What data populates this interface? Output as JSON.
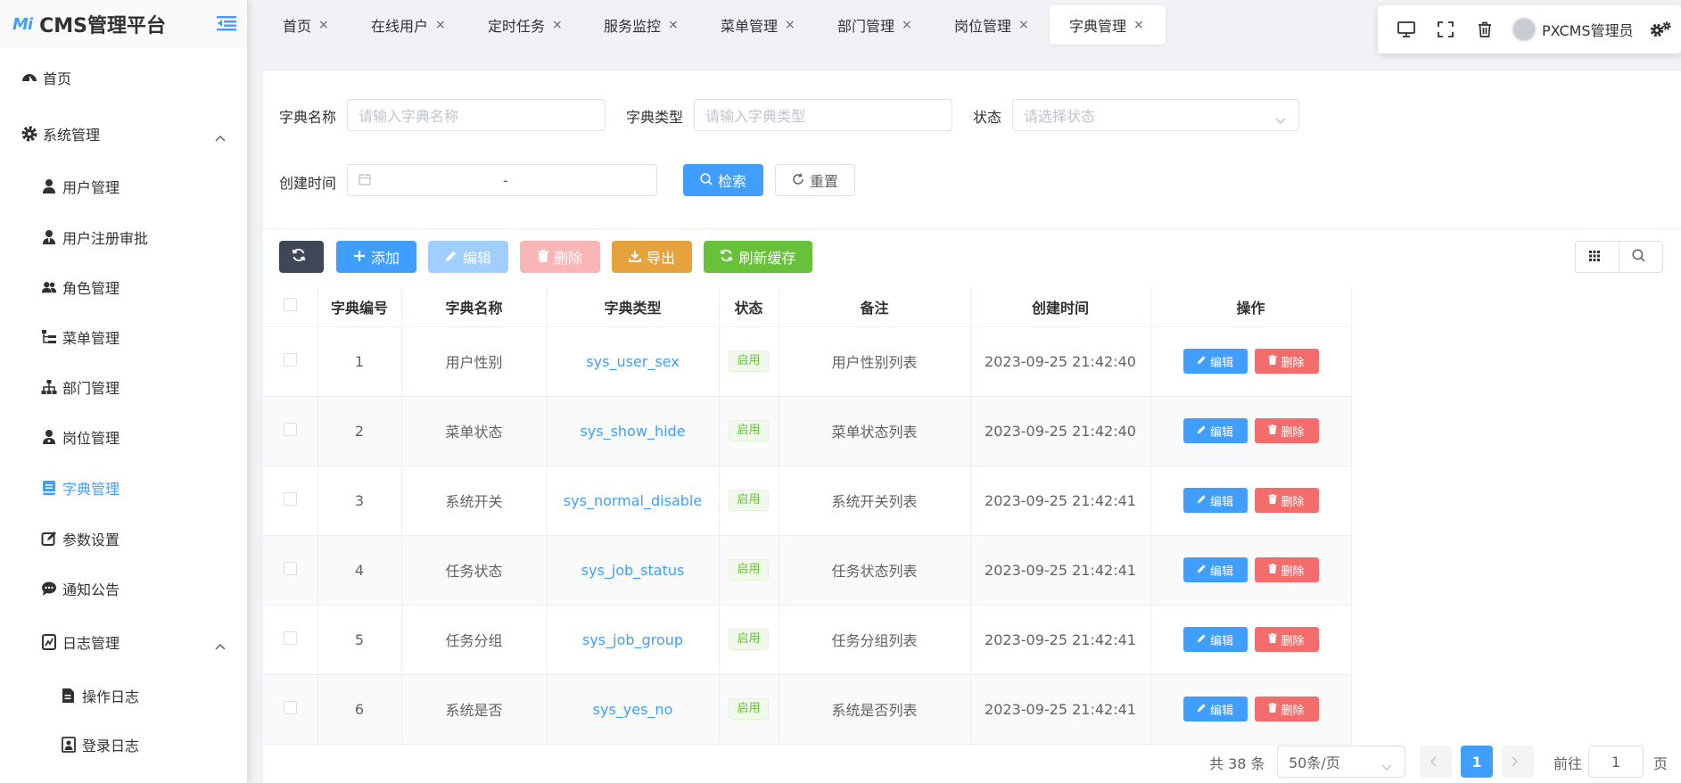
{
  "logo": {
    "mark": "Mi",
    "title": "CMS管理平台"
  },
  "sidebar": {
    "items": [
      {
        "label": "首页",
        "icon": "dashboard-icon"
      },
      {
        "label": "系统管理",
        "icon": "gear-icon"
      },
      {
        "label": "用户管理",
        "icon": "user-icon"
      },
      {
        "label": "用户注册审批",
        "icon": "user-tie-icon"
      },
      {
        "label": "角色管理",
        "icon": "users-icon"
      },
      {
        "label": "菜单管理",
        "icon": "tree-list-icon"
      },
      {
        "label": "部门管理",
        "icon": "sitemap-icon"
      },
      {
        "label": "岗位管理",
        "icon": "user-badge-icon"
      },
      {
        "label": "字典管理",
        "icon": "book-icon"
      },
      {
        "label": "参数设置",
        "icon": "edit-square-icon"
      },
      {
        "label": "通知公告",
        "icon": "comment-icon"
      },
      {
        "label": "日志管理",
        "icon": "chart-doc-icon"
      },
      {
        "label": "操作日志",
        "icon": "file-pen-icon"
      },
      {
        "label": "登录日志",
        "icon": "id-box-icon"
      }
    ]
  },
  "tabs": [
    {
      "label": "首页"
    },
    {
      "label": "在线用户"
    },
    {
      "label": "定时任务"
    },
    {
      "label": "服务监控"
    },
    {
      "label": "菜单管理"
    },
    {
      "label": "部门管理"
    },
    {
      "label": "岗位管理"
    },
    {
      "label": "字典管理"
    }
  ],
  "tab_close": "×",
  "user": {
    "name": "PXCMS管理员"
  },
  "search": {
    "name_label": "字典名称",
    "name_placeholder": "请输入字典名称",
    "type_label": "字典类型",
    "type_placeholder": "请输入字典类型",
    "status_label": "状态",
    "status_placeholder": "请选择状态",
    "time_label": "创建时间",
    "time_sep": "-",
    "search_btn": "检索",
    "reset_btn": "重置"
  },
  "toolbar": {
    "add": "添加",
    "edit": "编辑",
    "delete": "删除",
    "export": "导出",
    "refresh_cache": "刷新缓存"
  },
  "colors": {
    "primary": "#409eff",
    "success": "#67c23a",
    "danger": "#f56c6c",
    "warning": "#e6a23c",
    "dark": "#3f4656"
  },
  "table": {
    "headers": [
      "字典编号",
      "字典名称",
      "字典类型",
      "状态",
      "备注",
      "创建时间",
      "操作"
    ],
    "rows": [
      {
        "id": "1",
        "name": "用户性别",
        "type": "sys_user_sex",
        "status": "启用",
        "remark": "用户性别列表",
        "created": "2023-09-25 21:42:40"
      },
      {
        "id": "2",
        "name": "菜单状态",
        "type": "sys_show_hide",
        "status": "启用",
        "remark": "菜单状态列表",
        "created": "2023-09-25 21:42:40"
      },
      {
        "id": "3",
        "name": "系统开关",
        "type": "sys_normal_disable",
        "status": "启用",
        "remark": "系统开关列表",
        "created": "2023-09-25 21:42:41"
      },
      {
        "id": "4",
        "name": "任务状态",
        "type": "sys_job_status",
        "status": "启用",
        "remark": "任务状态列表",
        "created": "2023-09-25 21:42:41"
      },
      {
        "id": "5",
        "name": "任务分组",
        "type": "sys_job_group",
        "status": "启用",
        "remark": "任务分组列表",
        "created": "2023-09-25 21:42:41"
      },
      {
        "id": "6",
        "name": "系统是否",
        "type": "sys_yes_no",
        "status": "启用",
        "remark": "系统是否列表",
        "created": "2023-09-25 21:42:41"
      }
    ],
    "row_edit": "编辑",
    "row_delete": "删除"
  },
  "pagination": {
    "total": "共 38 条",
    "page_size": "50条/页",
    "current": "1",
    "goto_label": "前往",
    "goto_value": "1",
    "page_unit": "页"
  }
}
